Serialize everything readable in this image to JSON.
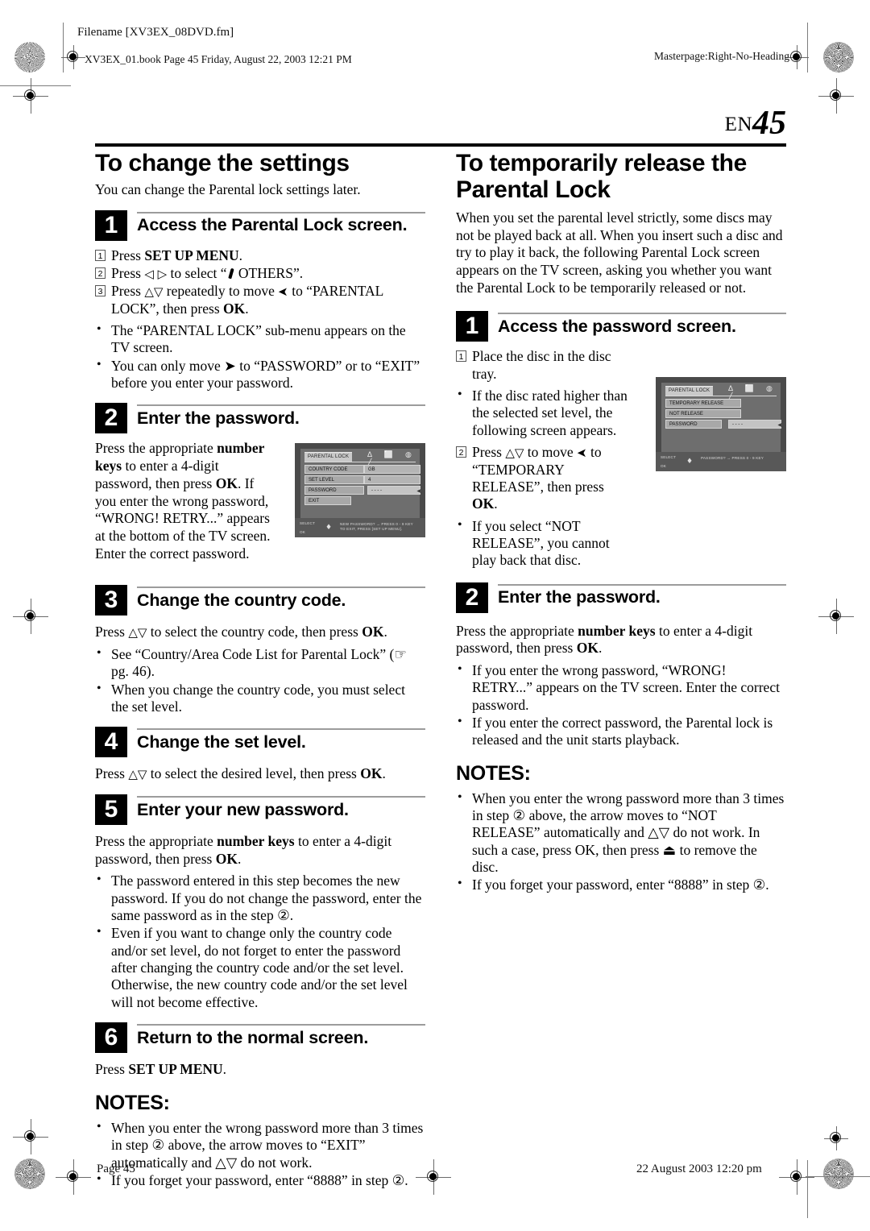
{
  "header": {
    "filename_slug": "Filename [XV3EX_08DVD.fm]",
    "book_slug": "XV3EX_01.book  Page 45  Friday, August 22, 2003  12:21 PM",
    "masterpage_slug": "Masterpage:Right-No-Heading"
  },
  "folio": {
    "lang": "EN",
    "page_number": "45"
  },
  "left_column": {
    "heading": "To change the settings",
    "intro": "You can change the Parental lock settings later.",
    "steps": [
      {
        "number": "1",
        "title": "Access the Parental Lock screen.",
        "substeps": [
          {
            "num": "1",
            "text_a": "Press ",
            "bold": "SET UP MENU",
            "text_b": "."
          },
          {
            "num": "2",
            "text_a": "Press ",
            "glyph": "◁ ▷",
            "text_b": " to select “",
            "icon": "wrench-icon",
            "text_c": " OTHERS”."
          },
          {
            "num": "3",
            "text_a": "Press ",
            "glyph": "△▽",
            "text_b": " repeatedly to move ",
            "glyph2": "➤",
            "text_c": " to “PARENTAL LOCK”, then press ",
            "bold": "OK",
            "text_d": "."
          }
        ],
        "bullets": [
          "The “PARENTAL LOCK” sub-menu appears on the TV screen.",
          "You can only move ➤ to “PASSWORD” or to “EXIT” before you enter your password."
        ]
      },
      {
        "number": "2",
        "title": "Enter the password.",
        "paragraph_a": "Press the appropriate ",
        "paragraph_bold": "number keys",
        "paragraph_b": " to enter a 4-digit password, then press ",
        "paragraph_bold2": "OK",
        "paragraph_c": ". If you enter the wrong password, “WRONG! RETRY...” appears at the bottom of the TV screen. Enter the correct password."
      },
      {
        "number": "3",
        "title": "Change the country code.",
        "paragraph_a": "Press ",
        "paragraph_glyph": "△▽",
        "paragraph_b": " to select the country code, then press ",
        "paragraph_bold": "OK",
        "paragraph_c": ".",
        "bullets": [
          "See “Country/Area Code List for Parental Lock” (☞ pg. 46).",
          "When you change the country code, you must select the set level."
        ]
      },
      {
        "number": "4",
        "title": "Change the set level.",
        "paragraph_a": "Press ",
        "paragraph_glyph": "△▽",
        "paragraph_b": " to select the desired level, then press ",
        "paragraph_bold": "OK",
        "paragraph_c": "."
      },
      {
        "number": "5",
        "title": "Enter your new password.",
        "paragraph_a": "Press the appropriate ",
        "paragraph_bold": "number keys",
        "paragraph_b": " to enter a 4-digit password, then press ",
        "paragraph_bold2": "OK",
        "paragraph_c": ".",
        "bullets": [
          "The password entered in this step becomes the new password. If you do not change the password, enter the same password as in the step ②.",
          "Even if you want to change only the country code and/or set level, do not forget to enter the password after changing the country code and/or the set level. Otherwise, the new country code and/or the set level will not become effective."
        ]
      },
      {
        "number": "6",
        "title": "Return to the normal screen.",
        "paragraph_a": "Press ",
        "paragraph_bold": "SET UP MENU",
        "paragraph_c": "."
      }
    ],
    "notes_heading": "NOTES:",
    "notes": [
      "When you enter the wrong password more than 3 times in step ② above, the arrow moves to “EXIT” automatically and △▽ do not work.",
      "If you forget your password, enter “8888” in step ②."
    ]
  },
  "right_column": {
    "heading": "To temporarily release the Parental Lock",
    "intro": "When you set the parental level strictly, some discs may not be played back at all. When you insert such a disc and try to play it back, the following Parental Lock screen appears on the TV screen, asking you whether you want the Parental Lock to be temporarily released or not.",
    "steps": [
      {
        "number": "1",
        "title": "Access the password screen.",
        "substeps": [
          {
            "num": "1",
            "text": "Place the disc in the disc tray."
          }
        ],
        "bullet1": "If the disc rated higher than the selected set level, the following screen appears.",
        "substep2": {
          "num": "2",
          "text_a": "Press ",
          "glyph": "△▽",
          "text_b": " to move ",
          "glyph2": "➤",
          "text_c": " to “TEMPORARY RELEASE”, then press ",
          "bold": "OK",
          "text_d": "."
        },
        "bullet2": "If you select “NOT RELEASE”, you cannot play back that disc."
      },
      {
        "number": "2",
        "title": "Enter the password.",
        "paragraph_a": "Press the appropriate ",
        "paragraph_bold": "number keys",
        "paragraph_b": " to enter a 4-digit password, then press ",
        "paragraph_bold2": "OK",
        "paragraph_c": ".",
        "bullets": [
          "If you enter the wrong password, “WRONG! RETRY...” appears on the TV screen. Enter the correct password.",
          "If you enter the correct password, the Parental lock is released and the unit starts playback."
        ]
      }
    ],
    "notes_heading": "NOTES:",
    "notes": [
      "When you enter the wrong password more than 3 times in step ② above, the arrow moves to “NOT RELEASE” automatically and △▽ do not work. In such a case, press OK, then press ⏏ to remove the disc.",
      "If you forget your password, enter “8888” in step ②."
    ]
  },
  "tv_screen_settings": {
    "tab_label": "PARENTAL LOCK",
    "tab_icons": "∆ ⬜ ◍ ╱",
    "rows": [
      {
        "label": "COUNTRY CODE",
        "value": "GB"
      },
      {
        "label": "SET LEVEL",
        "value": "4"
      },
      {
        "label": "PASSWORD",
        "value": "- - - -"
      },
      {
        "label": "EXIT",
        "value": ""
      }
    ],
    "guide_select": "SELECT",
    "guide_ok": "OK",
    "guide_line1": "NEW PASSWORD? → PRESS 0 - 9 KEY",
    "guide_line2": "TO EXIT, PRESS [SET UP MENU]."
  },
  "tv_screen_release": {
    "tab_label": "PARENTAL LOCK",
    "tab_icons": "∆ ⬜ ◍ ╱",
    "rows": [
      {
        "label": "TEMPORARY RELEASE",
        "value": ""
      },
      {
        "label": "NOT RELEASE",
        "value": ""
      },
      {
        "label": "PASSWORD",
        "value": "- - - -"
      }
    ],
    "guide_select": "SELECT",
    "guide_ok": "OK",
    "guide_line1": "PASSWORD? → PRESS 0 - 9 KEY",
    "guide_line2": ""
  },
  "footer": {
    "page_slug": "Page 45",
    "date_slug": "22 August 2003 12:20 pm"
  }
}
